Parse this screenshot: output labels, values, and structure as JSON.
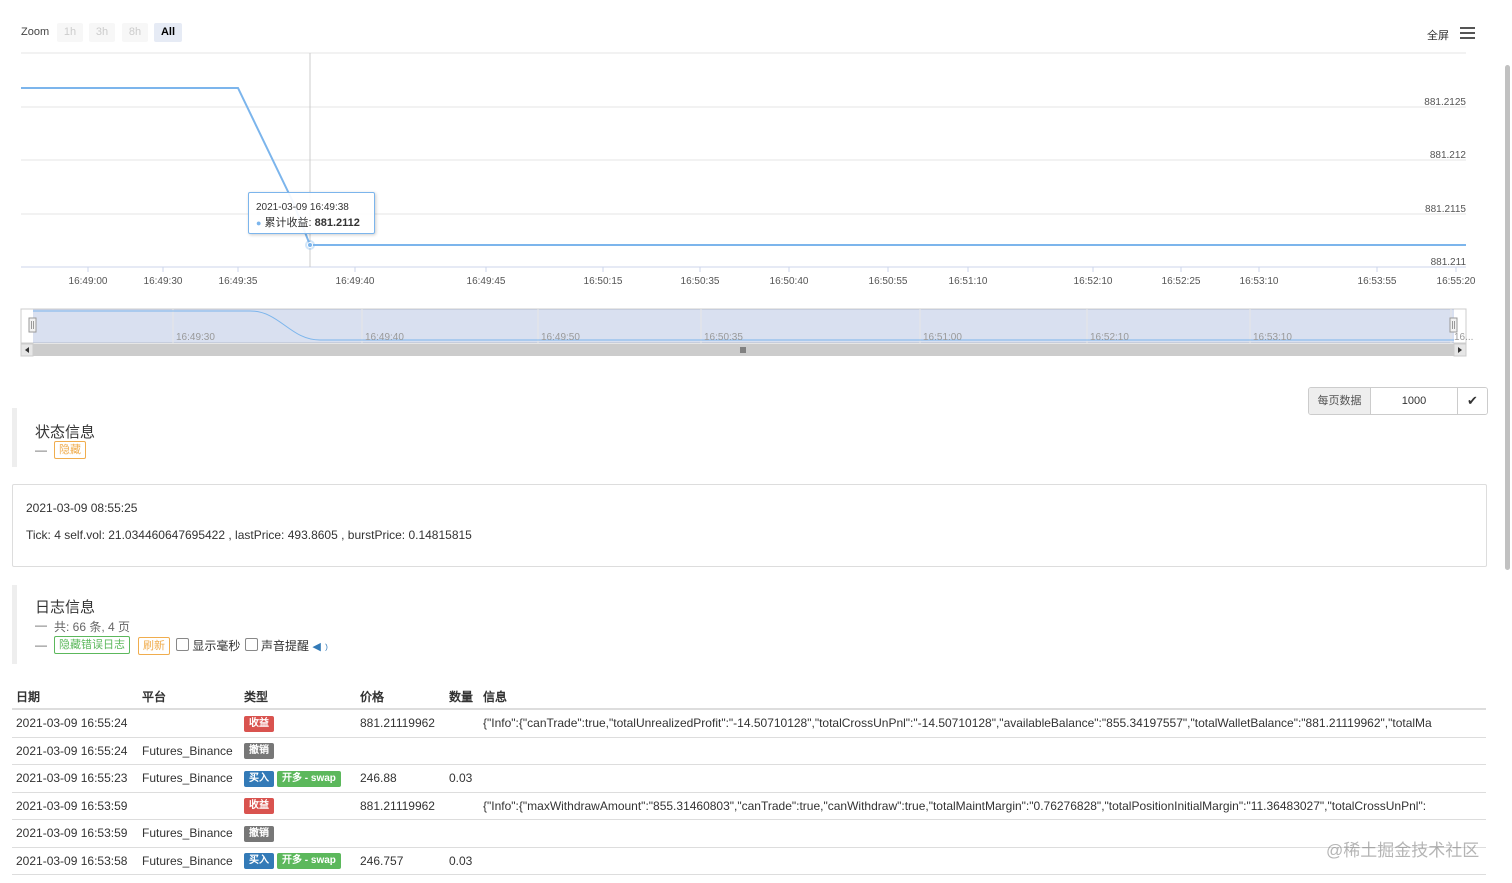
{
  "chart": {
    "zoom_label": "Zoom",
    "zoom_buttons": [
      "1h",
      "3h",
      "8h",
      "All"
    ],
    "fullscreen_label": "全屏",
    "menu_icon": "hamburger-menu-icon",
    "line_color": "#7cb5ec",
    "y_ticks": [
      "881.2125",
      "881.212",
      "881.2115",
      "881.211"
    ],
    "x_ticks": [
      "16:49:00",
      "16:49:30",
      "16:49:35",
      "16:49:40",
      "16:49:45",
      "16:50:15",
      "16:50:35",
      "16:50:40",
      "16:50:55",
      "16:51:10",
      "16:52:10",
      "16:52:25",
      "16:53:10",
      "16:53:55",
      "16:55:20"
    ],
    "navigator_ticks": [
      "16:49:30",
      "16:49:40",
      "16:49:50",
      "16:50:35",
      "16:51:00",
      "16:52:10",
      "16:53:10",
      "16..."
    ],
    "tooltip": {
      "date": "2021-03-09 16:49:38",
      "series_label": "累计收益:",
      "value": "881.2112"
    }
  },
  "page_size": {
    "label": "每页数据",
    "value": "1000",
    "confirm_icon": "checkmark-icon"
  },
  "status_section": {
    "title": "状态信息",
    "dash": "—",
    "hide_button": "隐藏",
    "date": "2021-03-09 08:55:25",
    "tick_text": "Tick: 4 self.vol: 21.034460647695422 , lastPrice: 493.8605 , burstPrice: 0.14815815"
  },
  "log_section": {
    "title": "日志信息",
    "dash": "—",
    "summary": "共: 66 条, 4 页",
    "hide_error_button": "隐藏错误日志",
    "refresh_button": "刷新",
    "show_ms_label": "显示毫秒",
    "sound_label": "声音提醒",
    "sound_icon": "speaker-icon"
  },
  "table": {
    "headers": [
      "日期",
      "平台",
      "类型",
      "价格",
      "数量",
      "信息"
    ],
    "rows": [
      {
        "date": "2021-03-09 16:55:24",
        "platform": "",
        "labels": [
          {
            "text": "收益",
            "color": "#d9534f"
          }
        ],
        "price": "881.21119962",
        "qty": "",
        "info": "{\"Info\":{\"canTrade\":true,\"totalUnrealizedProfit\":\"-14.50710128\",\"totalCrossUnPnl\":\"-14.50710128\",\"availableBalance\":\"855.34197557\",\"totalWalletBalance\":\"881.21119962\",\"totalMa"
      },
      {
        "date": "2021-03-09 16:55:24",
        "platform": "Futures_Binance",
        "labels": [
          {
            "text": "撤销",
            "color": "#777777"
          }
        ],
        "price": "",
        "qty": "",
        "info": ""
      },
      {
        "date": "2021-03-09 16:55:23",
        "platform": "Futures_Binance",
        "labels": [
          {
            "text": "买入",
            "color": "#337ab7"
          },
          {
            "text": "开多 - swap",
            "color": "#5cb85c"
          }
        ],
        "price": "246.88",
        "qty": "0.03",
        "info": ""
      },
      {
        "date": "2021-03-09 16:53:59",
        "platform": "",
        "labels": [
          {
            "text": "收益",
            "color": "#d9534f"
          }
        ],
        "price": "881.21119962",
        "qty": "",
        "info": "{\"Info\":{\"maxWithdrawAmount\":\"855.31460803\",\"canTrade\":true,\"canWithdraw\":true,\"totalMaintMargin\":\"0.76276828\",\"totalPositionInitialMargin\":\"11.36483027\",\"totalCrossUnPnl\":"
      },
      {
        "date": "2021-03-09 16:53:59",
        "platform": "Futures_Binance",
        "labels": [
          {
            "text": "撤销",
            "color": "#777777"
          }
        ],
        "price": "",
        "qty": "",
        "info": ""
      },
      {
        "date": "2021-03-09 16:53:58",
        "platform": "Futures_Binance",
        "labels": [
          {
            "text": "买入",
            "color": "#337ab7"
          },
          {
            "text": "开多 - swap",
            "color": "#5cb85c"
          }
        ],
        "price": "246.757",
        "qty": "0.03",
        "info": ""
      }
    ]
  },
  "watermark": "@稀土掘金技术社区"
}
